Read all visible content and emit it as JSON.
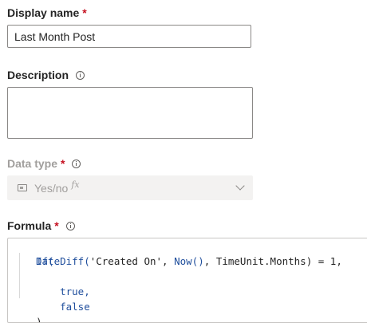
{
  "display_name": {
    "label": "Display name",
    "required_mark": "*",
    "value": "Last Month Post"
  },
  "description": {
    "label": "Description",
    "info_icon": "info-icon",
    "value": ""
  },
  "data_type": {
    "label": "Data type",
    "required_mark": "*",
    "info_icon": "info-icon",
    "type_icon": "yes-no-icon",
    "value": "Yes/no",
    "formula_marker": "fx",
    "disabled": true
  },
  "formula": {
    "label": "Formula",
    "required_mark": "*",
    "info_icon": "info-icon",
    "lines": {
      "l1_fn": "If(",
      "l2_fn": "DateDiff(",
      "l2_str": "'Created On'",
      "l2_sep1": ", ",
      "l2_fn2": "Now()",
      "l2_sep2": ", ",
      "l2_enum": "TimeUnit.Months",
      "l2_op": ") = 1,",
      "l3_bool": "true,",
      "l4_bool": "false",
      "l5_close": ")"
    }
  },
  "colors": {
    "required": "#c50f1f",
    "keyword": "#1f4e9c",
    "disabled_text": "#a19f9d",
    "input_border": "#8a8886"
  }
}
